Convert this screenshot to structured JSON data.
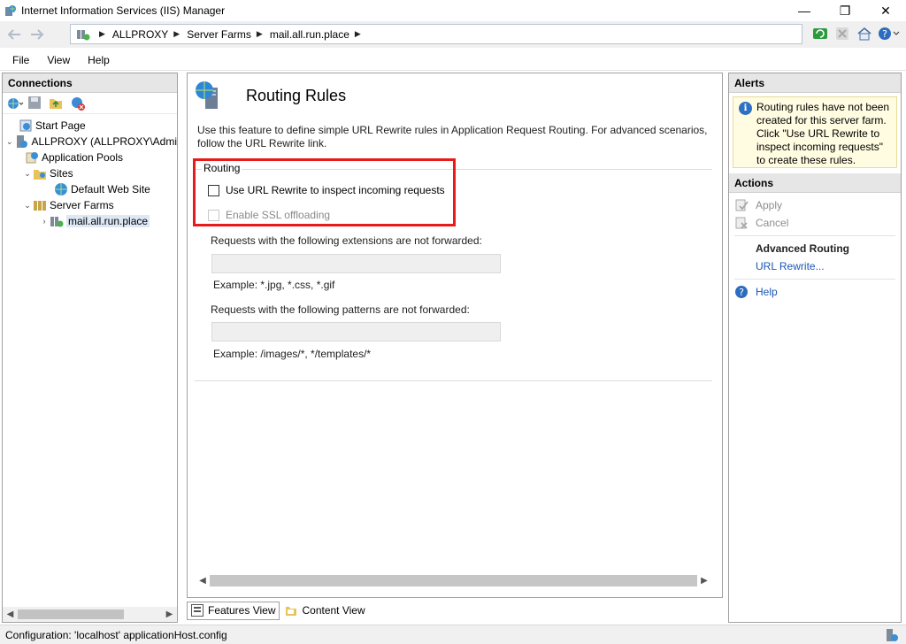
{
  "window": {
    "title": "Internet Information Services (IIS) Manager",
    "minimize": "—",
    "restore": "❐",
    "close": "✕"
  },
  "address": {
    "crumbs": [
      "ALLPROXY",
      "Server Farms",
      "mail.all.run.place"
    ]
  },
  "menu": {
    "file": "File",
    "view": "View",
    "help": "Help"
  },
  "connections": {
    "header": "Connections",
    "tree": {
      "start_page": "Start Page",
      "server": "ALLPROXY (ALLPROXY\\Admi",
      "app_pools": "Application Pools",
      "sites": "Sites",
      "default_site": "Default Web Site",
      "server_farms": "Server Farms",
      "farm": "mail.all.run.place"
    }
  },
  "main": {
    "title": "Routing Rules",
    "description": "Use this feature to define simple URL Rewrite rules in Application Request Routing.  For advanced scenarios, follow the URL Rewrite link.",
    "group_label": "Routing",
    "use_url_rewrite": {
      "label": "Use URL Rewrite to inspect incoming requests",
      "checked": false
    },
    "enable_ssl": {
      "label": "Enable SSL offloading",
      "checked": false,
      "enabled": false
    },
    "extensions_label": "Requests with the following extensions are not forwarded:",
    "extensions_value": "",
    "extensions_example": "Example: *.jpg, *.css, *.gif",
    "patterns_label": "Requests with the following patterns are not forwarded:",
    "patterns_value": "",
    "patterns_example": "Example: /images/*, */templates/*",
    "highlight_color": "#e81b1b"
  },
  "view_tabs": {
    "features": "Features View",
    "content": "Content View"
  },
  "right": {
    "alerts_header": "Alerts",
    "alert_text": "Routing rules have not been created for this server farm. Click \"Use URL Rewrite to inspect incoming requests\" to create these rules.",
    "actions_header": "Actions",
    "apply": "Apply",
    "cancel": "Cancel",
    "advanced_routing": "Advanced Routing",
    "url_rewrite": "URL Rewrite...",
    "help": "Help"
  },
  "status": {
    "text": "Configuration: 'localhost' applicationHost.config"
  }
}
